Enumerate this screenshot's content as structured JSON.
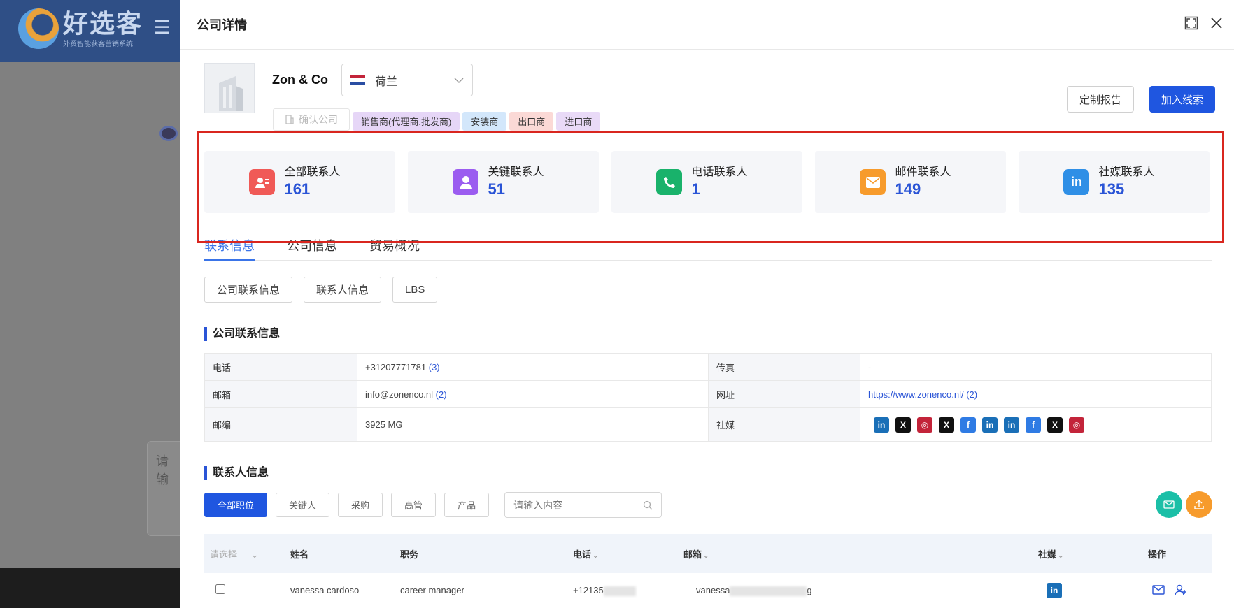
{
  "background": {
    "logo_title": "好选客",
    "logo_subtitle": "外贸智能获客营销系统",
    "input_placeholder": "请输"
  },
  "drawer": {
    "title": "公司详情"
  },
  "company": {
    "name": "Zon & Co",
    "country": "荷兰",
    "confirm_label": "确认公司",
    "tags": [
      {
        "label": "销售商(代理商,批发商)",
        "color": "#e6d6f7"
      },
      {
        "label": "安装商",
        "color": "#d3e7fb"
      },
      {
        "label": "出口商",
        "color": "#fbd9d6"
      },
      {
        "label": "进口商",
        "color": "#e9daf7"
      }
    ],
    "report_label": "定制报告",
    "add_label": "加入线索"
  },
  "stats": [
    {
      "label": "全部联系人",
      "value": "161",
      "icon": "contact-card-icon",
      "color": "#f05a57"
    },
    {
      "label": "关键联系人",
      "value": "51",
      "icon": "person-icon",
      "color": "#9b5cf0"
    },
    {
      "label": "电话联系人",
      "value": "1",
      "icon": "phone-icon",
      "color": "#19b26b"
    },
    {
      "label": "邮件联系人",
      "value": "149",
      "icon": "mail-icon",
      "color": "#f79b2c"
    },
    {
      "label": "社媒联系人",
      "value": "135",
      "icon": "linkedin-icon",
      "color": "#2f8fe6"
    }
  ],
  "tabs": [
    "联系信息",
    "公司信息",
    "贸易概况"
  ],
  "subtabs": [
    "公司联系信息",
    "联系人信息",
    "LBS"
  ],
  "company_contact": {
    "title": "公司联系信息",
    "phone_label": "电话",
    "phone": "+31207771781",
    "phone_count": "(3)",
    "fax_label": "传真",
    "fax": "-",
    "email_label": "邮箱",
    "email": "info@zonenco.nl",
    "email_count": "(2)",
    "website_label": "网址",
    "website": "https://www.zonenco.nl/",
    "website_count": "(2)",
    "zip_label": "邮编",
    "zip": "3925 MG",
    "social_label": "社媒",
    "social": [
      {
        "icon": "linkedin-icon",
        "glyph": "in",
        "color": "#1a6fb7"
      },
      {
        "icon": "x-icon",
        "glyph": "X",
        "color": "#111111"
      },
      {
        "icon": "instagram-icon",
        "glyph": "◎",
        "color": "#c3243a"
      },
      {
        "icon": "x-icon",
        "glyph": "X",
        "color": "#111111"
      },
      {
        "icon": "facebook-icon",
        "glyph": "f",
        "color": "#2f7be4"
      },
      {
        "icon": "linkedin-icon",
        "glyph": "in",
        "color": "#1a6fb7"
      },
      {
        "icon": "linkedin-icon",
        "glyph": "in",
        "color": "#1a6fb7"
      },
      {
        "icon": "facebook-icon",
        "glyph": "f",
        "color": "#2f7be4"
      },
      {
        "icon": "x-icon",
        "glyph": "X",
        "color": "#111111"
      },
      {
        "icon": "instagram-icon",
        "glyph": "◎",
        "color": "#c3243a"
      }
    ]
  },
  "contacts": {
    "title": "联系人信息",
    "filters": [
      "全部职位",
      "关键人",
      "采购",
      "高管",
      "产品"
    ],
    "search_placeholder": "请输入内容",
    "columns": {
      "select": "请选择",
      "name": "姓名",
      "title": "职务",
      "phone": "电话",
      "email": "邮箱",
      "social": "社媒",
      "action": "操作"
    },
    "rows": [
      {
        "name": "vanessa cardoso",
        "title": "career manager",
        "phone": "+12135",
        "email_prefix": "vanessa",
        "email_suffix": "g"
      }
    ]
  }
}
